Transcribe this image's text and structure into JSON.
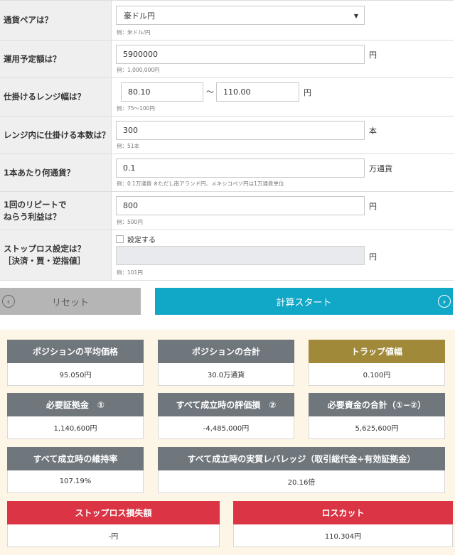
{
  "form": {
    "pair": {
      "label": "通貨ペアは？",
      "value": "豪ドル円",
      "example": "例：米ドル/円"
    },
    "amount": {
      "label": "運用予定額は？",
      "value": "5900000",
      "unit": "円",
      "example": "例：1,000,000円"
    },
    "range": {
      "label": "仕掛けるレンジ幅は？",
      "low": "80.10",
      "separator": "〜",
      "high": "110.00",
      "unit": "円",
      "example": "例：75〜100円"
    },
    "count": {
      "label": "レンジ内に仕掛ける本数は？",
      "value": "300",
      "unit": "本",
      "example": "例：51本"
    },
    "lot": {
      "label": "1本あたり何通貨？",
      "value": "0.1",
      "unit": "万通貨",
      "example": "例：0.1万通貨 ※ただし南アランド円、メキシコペソ円は1万通貨単位"
    },
    "profit": {
      "label_line1": "1回のリピートで",
      "label_line2": "ねらう利益は？",
      "value": "800",
      "unit": "円",
      "example": "例：500円"
    },
    "stoploss": {
      "label_line1": "ストップロス設定は？",
      "label_line2": "［決済・買・逆指値］",
      "checkbox_label": "設定する",
      "value": "",
      "unit": "円",
      "example": "例：101円"
    }
  },
  "buttons": {
    "reset": "リセット",
    "calc": "計算スタート"
  },
  "results": {
    "avg_price": {
      "title": "ポジションの平均価格",
      "value": "95.050円"
    },
    "position_total": {
      "title": "ポジションの合計",
      "value": "30.0万通貨"
    },
    "trap_width": {
      "title": "トラップ値幅",
      "value": "0.100円"
    },
    "margin": {
      "title": "必要証拠金　①",
      "value": "1,140,600円"
    },
    "unrealized": {
      "title": "すべて成立時の評価損　②",
      "value": "-4,485,000円"
    },
    "total_funds": {
      "title": "必要資金の合計（①−②）",
      "value": "5,625,600円"
    },
    "maintenance": {
      "title": "すべて成立時の維持率",
      "value": "107.19%"
    },
    "leverage": {
      "title": "すべて成立時の実質レバレッジ（取引総代金÷有効証拠金）",
      "value": "20.16倍"
    },
    "stoploss_loss": {
      "title": "ストップロス損失額",
      "value": "-円"
    },
    "losscut": {
      "title": "ロスカット",
      "value": "110.304円"
    }
  },
  "colors": {
    "accent": "#11a7c7",
    "header_gray": "#6f767c",
    "gold": "#a08a3a",
    "red": "#db3444",
    "results_bg": "#fdf5e6"
  }
}
